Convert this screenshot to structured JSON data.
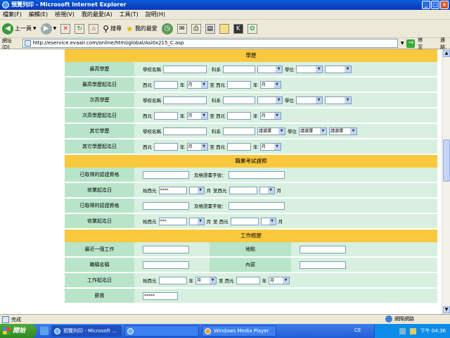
{
  "window": {
    "title": "預覽列印 - Microsoft Internet Explorer"
  },
  "menu": [
    "檔案(F)",
    "編輯(E)",
    "檢視(V)",
    "我的最愛(A)",
    "工具(T)",
    "說明(H)"
  ],
  "toolbar": {
    "back": "上一頁",
    "search": "搜尋",
    "favorites": "我的最愛"
  },
  "address": {
    "label": "網址(D)",
    "url": "http://eservice.evaair.com/online/html/global/Asi0x215_C.asp",
    "go": "移至",
    "links": "連結"
  },
  "form": {
    "education": {
      "section": "學歷",
      "school_label": "學校名稱",
      "dept_label": "科系",
      "degree_label": "學位",
      "from": "西元",
      "year": "年",
      "to": "至 西元",
      "month_default": "月",
      "rows": [
        {
          "label": "最高學歷",
          "dept_value": ".",
          "degree_value": ""
        },
        {
          "label": "最高學歷起迄日",
          "month1": "月",
          "month2": "月"
        },
        {
          "label": "次高學歷",
          "dept_value": ".",
          "degree_value": "."
        },
        {
          "label": "次高學歷起迄日",
          "month1": "月",
          "month2": "月"
        },
        {
          "label": "其它學歷",
          "select1": "請選擇",
          "select2": "請選擇",
          "select3": "請選擇"
        },
        {
          "label": "其它學歷起迄日",
          "month1": "月",
          "month2": "月"
        }
      ]
    },
    "license": {
      "section": "職業考試證照",
      "cert_label": "已取得的認證資格",
      "cert_no_label": "及格證書字號：",
      "period_label": "修業起迄日",
      "start": "始西元",
      "month": "月",
      "to": "至西元",
      "to2": "至 西元",
      "year_value": "****",
      "year_value2": "***"
    },
    "work": {
      "section": "工作經歷",
      "recent_label": "最近一個工作",
      "location_label": "地點",
      "title_label": "職稱名稱",
      "content_label": "內容",
      "period_label": "工作起迄日",
      "start": "始西元",
      "year": "年",
      "month": "月",
      "to": "至 西元",
      "salary_label": "薪資",
      "salary_value": "*****"
    }
  },
  "status": {
    "text": "完成",
    "zone": "網際網路"
  },
  "taskbar": {
    "start": "開始",
    "tasks": [
      "預覽列印 - Microsoft ...",
      "",
      "Windows Media Player"
    ],
    "lang": "CE",
    "clock": "下午 04:36"
  }
}
